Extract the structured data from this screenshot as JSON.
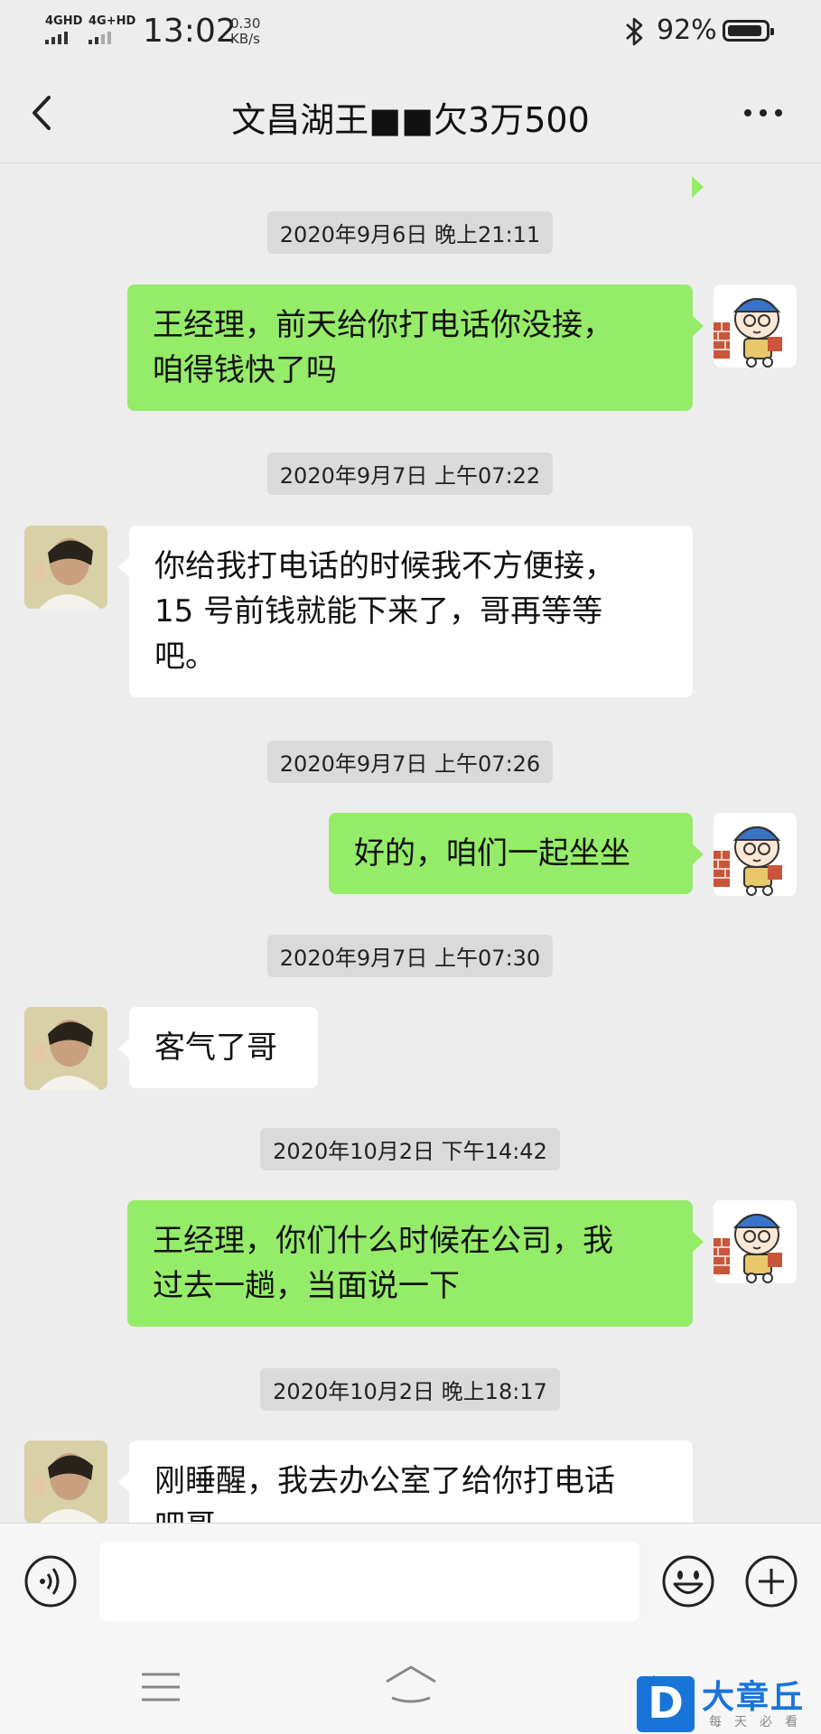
{
  "status_bar": {
    "signal_1": "4GHD",
    "signal_2": "4G+HD",
    "time": "13:02",
    "net_speed_value": "0.30",
    "net_speed_unit": "KB/s",
    "battery": "92%"
  },
  "header": {
    "title": "文昌湖王■■欠3万500"
  },
  "messages": [
    {
      "type": "timestamp",
      "text": "2020年9月6日 晚上21:11"
    },
    {
      "type": "message",
      "sender": "me",
      "lines": [
        "王经理，前天给你打电话你没接，",
        "咱得钱快了吗"
      ]
    },
    {
      "type": "timestamp",
      "text": "2020年9月7日 上午07:22"
    },
    {
      "type": "message",
      "sender": "them",
      "lines": [
        "你给我打电话的时候我不方便接，",
        "15 号前钱就能下来了，哥再等等",
        "吧。"
      ]
    },
    {
      "type": "timestamp",
      "text": "2020年9月7日 上午07:26"
    },
    {
      "type": "message",
      "sender": "me",
      "lines": [
        "好的，咱们一起坐坐"
      ]
    },
    {
      "type": "timestamp",
      "text": "2020年9月7日 上午07:30"
    },
    {
      "type": "message",
      "sender": "them",
      "lines": [
        "客气了哥"
      ]
    },
    {
      "type": "timestamp",
      "text": "2020年10月2日 下午14:42"
    },
    {
      "type": "message",
      "sender": "me",
      "lines": [
        "王经理，你们什么时候在公司，我",
        "过去一趟，当面说一下"
      ]
    },
    {
      "type": "timestamp",
      "text": "2020年10月2日 晚上18:17"
    },
    {
      "type": "message",
      "sender": "them",
      "lines": [
        "刚睡醒，我去办公室了给你打电话",
        "吧哥"
      ]
    }
  ],
  "input_bar": {
    "voice_icon": "voice-icon",
    "emoji_icon": "emoji-icon",
    "plus_icon": "plus-icon",
    "text": ""
  },
  "watermark": {
    "logo_letter": "D",
    "name": "大章丘",
    "slogan": "每天必看"
  },
  "colors": {
    "my_bubble": "#95ec69",
    "their_bubble": "#ffffff",
    "background": "#ededed",
    "watermark_blue": "#1874d8"
  }
}
